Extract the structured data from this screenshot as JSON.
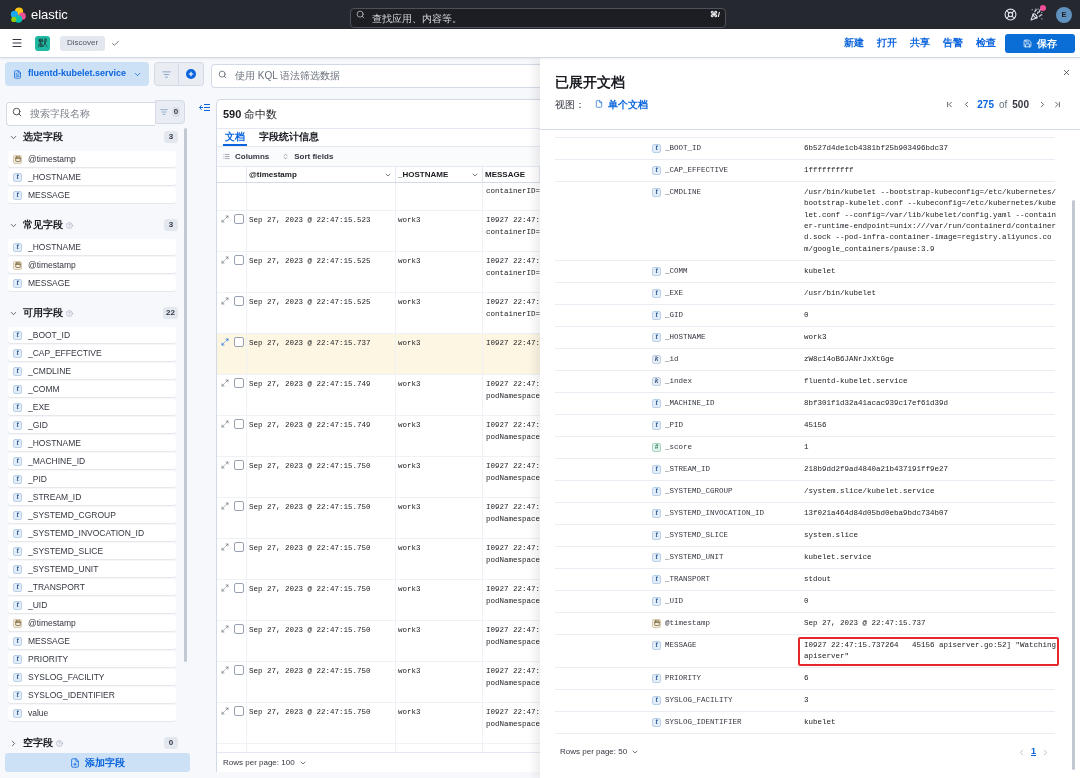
{
  "header": {
    "logo_text": "elastic",
    "search": {
      "placeholder": "查找应用、内容等。",
      "shortcut": "⌘/"
    },
    "newsfeed": {
      "unread": true
    },
    "avatar": "E"
  },
  "app_bar": {
    "space": "默",
    "breadcrumb": "Discover",
    "menu": [
      "新建",
      "打开",
      "共享",
      "告警",
      "检查"
    ],
    "save": "保存"
  },
  "query_bar": {
    "data_view": "fluentd-kubelet.service",
    "placeholder": "使用 KQL 语法筛选数据"
  },
  "sidebar": {
    "search": {
      "placeholder": "搜索字段名称"
    },
    "filter_count": "0",
    "sections": [
      {
        "title": "选定字段",
        "count": "3",
        "expanded": true,
        "help": false,
        "fields": [
          {
            "name": "@timestamp",
            "kind": "date"
          },
          {
            "name": "_HOSTNAME",
            "kind": "text",
            "token": "t"
          },
          {
            "name": "MESSAGE",
            "kind": "text",
            "token": "t"
          }
        ]
      },
      {
        "title": "常见字段",
        "count": "3",
        "expanded": true,
        "help": true,
        "fields": [
          {
            "name": "_HOSTNAME",
            "kind": "text",
            "token": "t"
          },
          {
            "name": "@timestamp",
            "kind": "date"
          },
          {
            "name": "MESSAGE",
            "kind": "text",
            "token": "t"
          }
        ]
      },
      {
        "title": "可用字段",
        "count": "22",
        "expanded": true,
        "help": true,
        "fields": [
          {
            "name": "_BOOT_ID",
            "kind": "text",
            "token": "t"
          },
          {
            "name": "_CAP_EFFECTIVE",
            "kind": "text",
            "token": "t"
          },
          {
            "name": "_CMDLINE",
            "kind": "text",
            "token": "t"
          },
          {
            "name": "_COMM",
            "kind": "text",
            "token": "t"
          },
          {
            "name": "_EXE",
            "kind": "text",
            "token": "t"
          },
          {
            "name": "_GID",
            "kind": "text",
            "token": "t"
          },
          {
            "name": "_HOSTNAME",
            "kind": "text",
            "token": "t"
          },
          {
            "name": "_MACHINE_ID",
            "kind": "text",
            "token": "t"
          },
          {
            "name": "_PID",
            "kind": "text",
            "token": "t"
          },
          {
            "name": "_STREAM_ID",
            "kind": "text",
            "token": "t"
          },
          {
            "name": "_SYSTEMD_CGROUP",
            "kind": "text",
            "token": "t"
          },
          {
            "name": "_SYSTEMD_INVOCATION_ID",
            "kind": "text",
            "token": "t"
          },
          {
            "name": "_SYSTEMD_SLICE",
            "kind": "text",
            "token": "t"
          },
          {
            "name": "_SYSTEMD_UNIT",
            "kind": "text",
            "token": "t"
          },
          {
            "name": "_TRANSPORT",
            "kind": "text",
            "token": "t"
          },
          {
            "name": "_UID",
            "kind": "text",
            "token": "t"
          },
          {
            "name": "@timestamp",
            "kind": "date"
          },
          {
            "name": "MESSAGE",
            "kind": "text",
            "token": "t"
          },
          {
            "name": "PRIORITY",
            "kind": "text",
            "token": "t"
          },
          {
            "name": "SYSLOG_FACILITY",
            "kind": "text",
            "token": "t"
          },
          {
            "name": "SYSLOG_IDENTIFIER",
            "kind": "text",
            "token": "t"
          },
          {
            "name": "value",
            "kind": "text",
            "token": "t"
          }
        ]
      },
      {
        "title": "空字段",
        "count": "0",
        "expanded": false,
        "help": true
      }
    ],
    "add_button": "添加字段"
  },
  "results": {
    "hits": "**590** 命中数",
    "tabs": [
      {
        "label": "文档",
        "selected": true
      },
      {
        "label": "字段统计信息",
        "selected": false
      }
    ],
    "toolbar": [
      {
        "kind": "columns",
        "label": "Columns"
      },
      {
        "kind": "sort",
        "label": "Sort fields"
      }
    ],
    "columns": [
      {
        "label": "@timestamp",
        "menu": true
      },
      {
        "label": "_HOSTNAME",
        "menu": true
      },
      {
        "label": "MESSAGE",
        "menu": false
      }
    ],
    "rows": [
      {
        "kind": "continuation",
        "selected": false,
        "message": [
          "containerID="
        ]
      },
      {
        "kind": "record",
        "selected": false,
        "checked": false,
        "timestamp": "Sep 27, 2023 @ 22:47:15.523",
        "hostname": "work3",
        "message": [
          "I0927 22:47:",
          "containerID="
        ]
      },
      {
        "kind": "record",
        "selected": false,
        "checked": false,
        "timestamp": "Sep 27, 2023 @ 22:47:15.525",
        "hostname": "work3",
        "message": [
          "I0927 22:47:",
          "containerID="
        ]
      },
      {
        "kind": "record",
        "selected": false,
        "checked": false,
        "timestamp": "Sep 27, 2023 @ 22:47:15.525",
        "hostname": "work3",
        "message": [
          "I0927 22:47:",
          "containerID="
        ]
      },
      {
        "kind": "record",
        "selected": true,
        "checked": false,
        "timestamp": "Sep 27, 2023 @ 22:47:15.737",
        "hostname": "work3",
        "message": [
          "I0927 22:47:"
        ]
      },
      {
        "kind": "record",
        "selected": false,
        "checked": false,
        "timestamp": "Sep 27, 2023 @ 22:47:15.749",
        "hostname": "work3",
        "message": [
          "I0927 22:47:",
          "podNamespace"
        ]
      },
      {
        "kind": "record",
        "selected": false,
        "checked": false,
        "timestamp": "Sep 27, 2023 @ 22:47:15.749",
        "hostname": "work3",
        "message": [
          "I0927 22:47:",
          "podNamespace"
        ]
      },
      {
        "kind": "record",
        "selected": false,
        "checked": false,
        "timestamp": "Sep 27, 2023 @ 22:47:15.750",
        "hostname": "work3",
        "message": [
          "I0927 22:47:",
          "podNamespace"
        ]
      },
      {
        "kind": "record",
        "selected": false,
        "checked": false,
        "timestamp": "Sep 27, 2023 @ 22:47:15.750",
        "hostname": "work3",
        "message": [
          "I0927 22:47:",
          "podNamespace"
        ]
      },
      {
        "kind": "record",
        "selected": false,
        "checked": false,
        "timestamp": "Sep 27, 2023 @ 22:47:15.750",
        "hostname": "work3",
        "message": [
          "I0927 22:47:",
          "podNamespace"
        ]
      },
      {
        "kind": "record",
        "selected": false,
        "checked": false,
        "timestamp": "Sep 27, 2023 @ 22:47:15.750",
        "hostname": "work3",
        "message": [
          "I0927 22:47:",
          "podNamespace"
        ]
      },
      {
        "kind": "record",
        "selected": false,
        "checked": false,
        "timestamp": "Sep 27, 2023 @ 22:47:15.750",
        "hostname": "work3",
        "message": [
          "I0927 22:47:",
          "podNamespace"
        ]
      },
      {
        "kind": "record",
        "selected": false,
        "checked": false,
        "timestamp": "Sep 27, 2023 @ 22:47:15.750",
        "hostname": "work3",
        "message": [
          "I0927 22:47:",
          "podNamespace"
        ]
      },
      {
        "kind": "record",
        "selected": false,
        "checked": false,
        "timestamp": "Sep 27, 2023 @ 22:47:15.750",
        "hostname": "work3",
        "message": [
          "I0927 22:47:",
          "podNamespace"
        ]
      }
    ],
    "footer": "Rows per page: 100"
  },
  "flyout": {
    "title": "已展开文档",
    "view_label": "视图：",
    "view_mode": "单个文档",
    "pagination": {
      "current": "275",
      "of": "of",
      "total": "500"
    },
    "fields": [
      {
        "kind": "text",
        "token": "t",
        "name": "_BOOT_ID",
        "value": "6b527d4de1cb4381bf25b903496bdc37",
        "highlighted": false
      },
      {
        "kind": "text",
        "token": "t",
        "name": "_CAP_EFFECTIVE",
        "value": "1ffffffffff",
        "highlighted": false
      },
      {
        "kind": "text",
        "token": "t",
        "name": "_CMDLINE",
        "value": "/usr/bin/kubelet --bootstrap-kubeconfig=/etc/kubernetes/bootstrap-kubelet.conf --kubeconfig=/etc/kubernetes/kubelet.conf --config=/var/lib/kubelet/config.yaml --container-runtime-endpoint=unix:///var/run/containerd/containerd.sock --pod-infra-container-image=registry.aliyuncs.com/google_containers/pause:3.9",
        "highlighted": false
      },
      {
        "kind": "text",
        "token": "t",
        "name": "_COMM",
        "value": "kubelet",
        "highlighted": false
      },
      {
        "kind": "text",
        "token": "t",
        "name": "_EXE",
        "value": "/usr/bin/kubelet",
        "highlighted": false
      },
      {
        "kind": "text",
        "token": "t",
        "name": "_GID",
        "value": "0",
        "highlighted": false
      },
      {
        "kind": "text",
        "token": "t",
        "name": "_HOSTNAME",
        "value": "work3",
        "highlighted": false
      },
      {
        "kind": "keyword",
        "token": "k",
        "name": "_id",
        "value": "zW8c14oB6JANrJxXtGge",
        "highlighted": false
      },
      {
        "kind": "keyword",
        "token": "k",
        "name": "_index",
        "value": "fluentd-kubelet.service",
        "highlighted": false
      },
      {
        "kind": "text",
        "token": "t",
        "name": "_MACHINE_ID",
        "value": "8bf301f1d32a41acac939c17ef61d39d",
        "highlighted": false
      },
      {
        "kind": "text",
        "token": "t",
        "name": "_PID",
        "value": "45156",
        "highlighted": false
      },
      {
        "kind": "number",
        "token": "#",
        "name": "_score",
        "value": "1",
        "highlighted": false
      },
      {
        "kind": "text",
        "token": "t",
        "name": "_STREAM_ID",
        "value": "218b9dd2f9ad4840a21b437191ff9e27",
        "highlighted": false
      },
      {
        "kind": "text",
        "token": "t",
        "name": "_SYSTEMD_CGROUP",
        "value": "/system.slice/kubelet.service",
        "highlighted": false
      },
      {
        "kind": "text",
        "token": "t",
        "name": "_SYSTEMD_INVOCATION_ID",
        "value": "13f021a464d84d05bd0eba9bdc734b07",
        "highlighted": false
      },
      {
        "kind": "text",
        "token": "t",
        "name": "_SYSTEMD_SLICE",
        "value": "system.slice",
        "highlighted": false
      },
      {
        "kind": "text",
        "token": "t",
        "name": "_SYSTEMD_UNIT",
        "value": "kubelet.service",
        "highlighted": false
      },
      {
        "kind": "text",
        "token": "t",
        "name": "_TRANSPORT",
        "value": "stdout",
        "highlighted": false
      },
      {
        "kind": "text",
        "token": "t",
        "name": "_UID",
        "value": "0",
        "highlighted": false
      },
      {
        "kind": "date",
        "name": "@timestamp",
        "value": "Sep 27, 2023 @ 22:47:15.737",
        "highlighted": false
      },
      {
        "kind": "text",
        "token": "t",
        "name": "MESSAGE",
        "value": "I0927 22:47:15.737264   45156 apiserver.go:52] \"Watching apiserver\"",
        "highlighted": true
      },
      {
        "kind": "text",
        "token": "t",
        "name": "PRIORITY",
        "value": "6",
        "highlighted": false
      },
      {
        "kind": "text",
        "token": "t",
        "name": "SYSLOG_FACILITY",
        "value": "3",
        "highlighted": false
      },
      {
        "kind": "text",
        "token": "t",
        "name": "SYSLOG_IDENTIFIER",
        "value": "kubelet",
        "highlighted": false
      }
    ],
    "footer": "Rows per page: 50",
    "pages": [
      {
        "label": "1",
        "selected": true
      }
    ]
  }
}
